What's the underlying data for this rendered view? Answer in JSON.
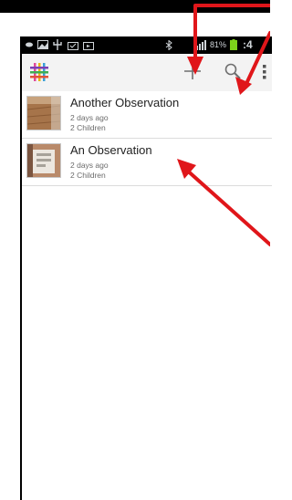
{
  "status_bar": {
    "battery": "81%",
    "time": ":4"
  },
  "action_bar": {
    "icons": [
      "grid-logo-icon",
      "plus-icon",
      "search-icon",
      "overflow-menu-icon"
    ]
  },
  "observations": [
    {
      "title": "Another Observation",
      "time": "2 days ago",
      "children": "2 Children",
      "thumb": "wood-texture"
    },
    {
      "title": "An Observation",
      "time": "2 days ago",
      "children": "2 Children",
      "thumb": "paper-photo"
    }
  ],
  "annotation": {
    "arrow_color": "#e0161a"
  }
}
